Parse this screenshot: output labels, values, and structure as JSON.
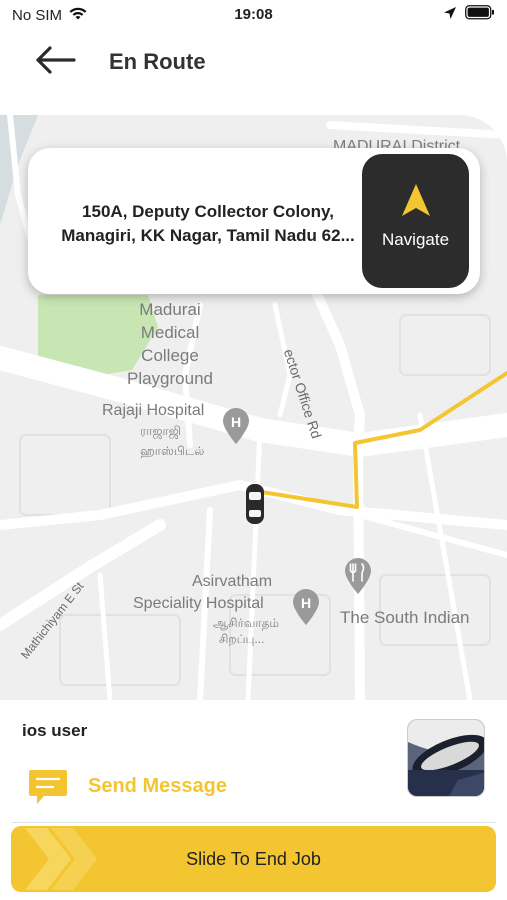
{
  "status_bar": {
    "carrier": "No SIM",
    "time": "19:08"
  },
  "header": {
    "title": "En Route"
  },
  "address_card": {
    "address_line1": "150A, Deputy Collector Colony,",
    "address_line2": "Managiri, KK Nagar, Tamil Nadu 62...",
    "navigate_label": "Navigate"
  },
  "map": {
    "labels": {
      "district": "MADURAI District",
      "playground_1": "Madurai",
      "playground_2": "Medical",
      "playground_3": "College",
      "playground_4": "Playground",
      "road_collector": "ector Office Rd",
      "rajaji": "Rajaji Hospital",
      "rajaji_tamil_1": "ராஜாஜி",
      "rajaji_tamil_2": "ஹாஸ்பிடல்",
      "asirvatham_1": "Asirvatham",
      "asirvatham_2": "Speciality Hospital",
      "asirvatham_tamil_1": "ஆசிர்வாதம்",
      "asirvatham_tamil_2": "சிறப்பு...",
      "south_indian": "The South Indian",
      "street": "Mathichiyam E St"
    }
  },
  "bottom_panel": {
    "user_name": "ios user",
    "send_message_label": "Send Message",
    "slide_label": "Slide To End Job"
  },
  "colors": {
    "accent": "#f3c631",
    "dark_button": "#2c2c2c",
    "route": "#f3c631",
    "map_bg": "#efefef",
    "park": "#c8e6b4"
  }
}
